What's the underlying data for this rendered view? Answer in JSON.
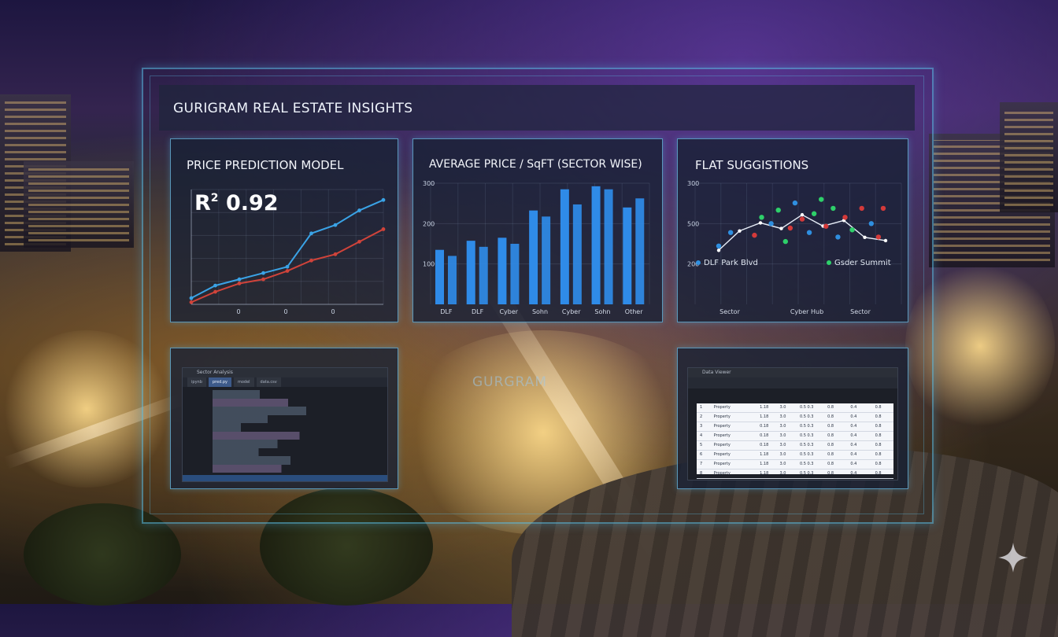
{
  "dashboard": {
    "title": "GURIGRAM REAL ESTATE INSIGHTS"
  },
  "prediction_panel": {
    "title": "PRICE PREDICTION MODEL",
    "metric_label": "R",
    "metric_sup": "2",
    "metric_value": "0.92",
    "x_ticks": [
      "0",
      "0",
      "0"
    ]
  },
  "price_panel": {
    "title": "AVERAGE PRICE / SqFT (SECTOR WISE)",
    "y_ticks": [
      "300",
      "200",
      "100"
    ]
  },
  "suggestions_panel": {
    "title": "FLAT SUGGISTIONS",
    "y_ticks": [
      "300",
      "500",
      "200"
    ],
    "x_labels": [
      "Sector",
      "Cyber Hub",
      "Sector"
    ],
    "legend": [
      {
        "label": "DLF Park Blvd",
        "color": "#2f8fe0"
      },
      {
        "label": "Gsder Summit",
        "color": "#2ed06a"
      }
    ]
  },
  "ide_panel": {
    "window_title": "Sector Analysis",
    "tabs": [
      "ipynb",
      "pred.py",
      "model",
      "data.csv"
    ]
  },
  "table_panel": {
    "window_title": "Data Viewer",
    "rows": [
      [
        "1",
        "Property",
        "1.18",
        "3.0",
        "0.5 0.3",
        "0.8",
        "0.4",
        "0.8"
      ],
      [
        "2",
        "Property",
        "1.18",
        "3.0",
        "0.5 0.3",
        "0.8",
        "0.4",
        "0.8"
      ],
      [
        "3",
        "Property",
        "0.18",
        "3.0",
        "0.5 0.3",
        "0.8",
        "0.4",
        "0.8"
      ],
      [
        "4",
        "Property",
        "0.18",
        "3.0",
        "0.5 0.3",
        "0.8",
        "0.4",
        "0.8"
      ],
      [
        "5",
        "Property",
        "0.18",
        "3.0",
        "0.5 0.3",
        "0.8",
        "0.4",
        "0.8"
      ],
      [
        "6",
        "Property",
        "1.18",
        "3.0",
        "0.5 0.3",
        "0.8",
        "0.4",
        "0.8"
      ],
      [
        "7",
        "Property",
        "1.18",
        "3.0",
        "0.5 0.3",
        "0.8",
        "0.4",
        "0.8"
      ],
      [
        "8",
        "Property",
        "1.18",
        "3.0",
        "0.5 0.3",
        "0.8",
        "0.4",
        "0.8"
      ]
    ]
  },
  "center_sign": "GURGRAM",
  "chart_data": [
    {
      "type": "line",
      "title": "PRICE PREDICTION MODEL",
      "x": [
        0,
        1,
        2,
        3,
        4,
        5,
        6,
        7,
        8
      ],
      "series": [
        {
          "color": "#3aa3e6",
          "values": [
            0.3,
            0.9,
            1.2,
            1.5,
            1.8,
            3.4,
            3.8,
            4.5,
            5.0
          ]
        },
        {
          "color": "#d0433a",
          "values": [
            0.1,
            0.6,
            1.0,
            1.2,
            1.6,
            2.1,
            2.4,
            3.0,
            3.6
          ]
        }
      ],
      "ylim": [
        0,
        5.5
      ]
    },
    {
      "type": "bar",
      "title": "AVERAGE PRICE / SqFT (SECTOR WISE)",
      "categories": [
        "DLF",
        "DLF",
        "Cyber",
        "Sohn",
        "Cyber",
        "Sohn",
        "Other"
      ],
      "series": [
        {
          "values": [
            180,
            210,
            220,
            310,
            380,
            390,
            320
          ]
        },
        {
          "values": [
            160,
            190,
            200,
            290,
            330,
            380,
            350
          ]
        }
      ],
      "ylim": [
        0,
        400
      ],
      "color": "#2f8be8"
    },
    {
      "type": "scatter",
      "title": "FLAT SUGGISTIONS",
      "points": [
        {
          "x": 0.3,
          "y": 0.3,
          "c": "#2f8fe0"
        },
        {
          "x": 0.35,
          "y": 0.45,
          "c": "#2f8fe0"
        },
        {
          "x": 0.45,
          "y": 0.42,
          "c": "#d43a3a"
        },
        {
          "x": 0.48,
          "y": 0.62,
          "c": "#2ed06a"
        },
        {
          "x": 0.52,
          "y": 0.55,
          "c": "#2f8fe0"
        },
        {
          "x": 0.55,
          "y": 0.7,
          "c": "#2ed06a"
        },
        {
          "x": 0.58,
          "y": 0.35,
          "c": "#2ed06a"
        },
        {
          "x": 0.6,
          "y": 0.5,
          "c": "#d43a3a"
        },
        {
          "x": 0.62,
          "y": 0.78,
          "c": "#2f8fe0"
        },
        {
          "x": 0.65,
          "y": 0.6,
          "c": "#d43a3a"
        },
        {
          "x": 0.68,
          "y": 0.45,
          "c": "#2f8fe0"
        },
        {
          "x": 0.7,
          "y": 0.66,
          "c": "#2ed06a"
        },
        {
          "x": 0.73,
          "y": 0.82,
          "c": "#2ed06a"
        },
        {
          "x": 0.75,
          "y": 0.52,
          "c": "#d43a3a"
        },
        {
          "x": 0.78,
          "y": 0.72,
          "c": "#2ed06a"
        },
        {
          "x": 0.8,
          "y": 0.4,
          "c": "#2f8fe0"
        },
        {
          "x": 0.83,
          "y": 0.62,
          "c": "#d43a3a"
        },
        {
          "x": 0.86,
          "y": 0.48,
          "c": "#2ed06a"
        },
        {
          "x": 0.9,
          "y": 0.72,
          "c": "#d43a3a"
        },
        {
          "x": 0.94,
          "y": 0.55,
          "c": "#2f8fe0"
        },
        {
          "x": 0.97,
          "y": 0.4,
          "c": "#d43a3a"
        },
        {
          "x": 0.99,
          "y": 0.72,
          "c": "#d43a3a"
        }
      ],
      "trend": [
        0.28,
        0.52,
        0.62,
        0.55,
        0.72,
        0.58,
        0.65,
        0.44,
        0.4
      ],
      "legend_position": "bottom"
    }
  ]
}
